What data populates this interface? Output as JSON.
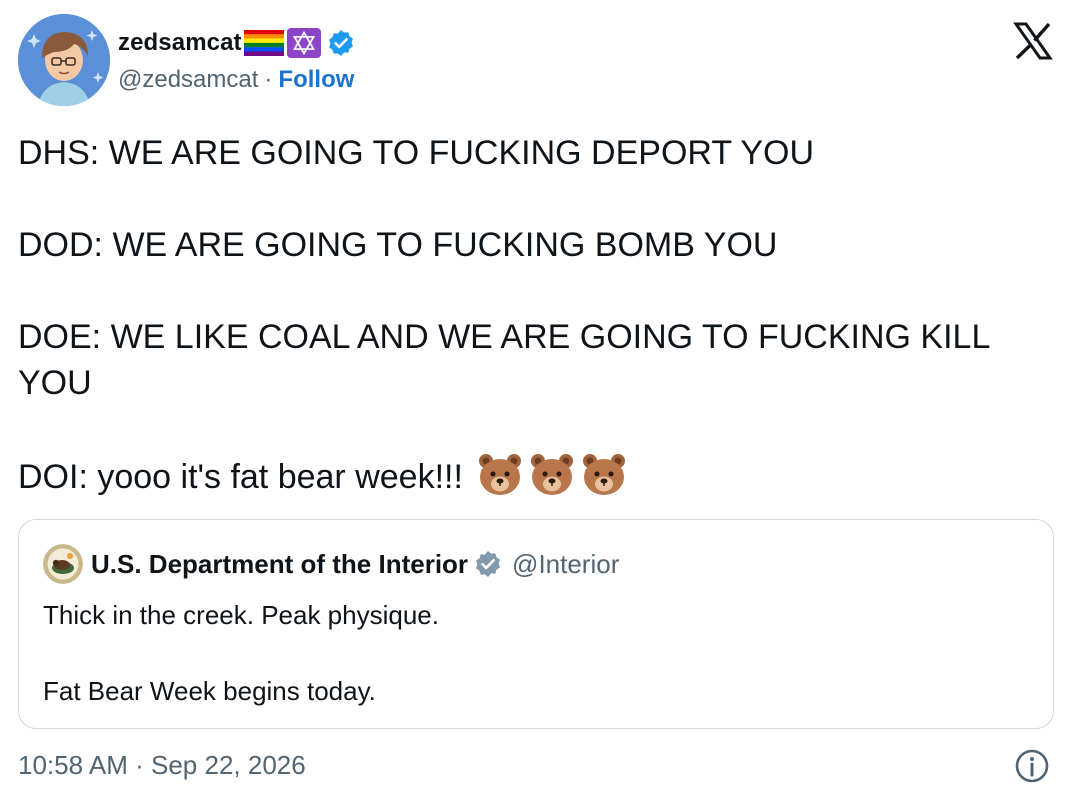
{
  "author": {
    "display_name": "zedsamcat",
    "handle": "@zedsamcat",
    "separator": "·",
    "follow_label": "Follow",
    "verified_color": "#1d9bf0"
  },
  "tweet": {
    "lines": [
      "DHS: WE ARE GOING TO FUCKING DEPORT YOU",
      "DOD: WE ARE GOING TO FUCKING BOMB YOU",
      "DOE: WE LIKE COAL AND WE ARE GOING TO FUCKING KILL YOU",
      "DOI: yooo it's fat bear week!!!"
    ],
    "emoji": [
      "bear-face-icon",
      "bear-face-icon",
      "bear-face-icon"
    ]
  },
  "quoted": {
    "name": "U.S. Department of the Interior",
    "handle": "@Interior",
    "verified_color": "#829aab",
    "lines": [
      "Thick in the creek. Peak physique.",
      "Fat Bear Week begins today."
    ]
  },
  "footer": {
    "time": "10:58 AM",
    "separator": "·",
    "date": "Sep 22, 2026"
  },
  "colors": {
    "text": "#0f1419",
    "secondary": "#536471",
    "link": "#1d74d0",
    "border": "#cfd9de"
  }
}
